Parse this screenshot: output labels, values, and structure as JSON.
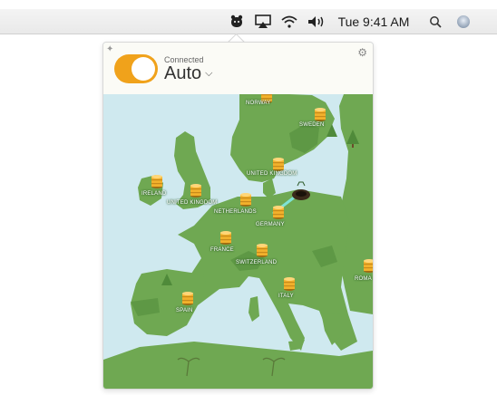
{
  "menubar": {
    "clock": "Tue 9:41 AM",
    "icons": [
      "tunnelbear-icon",
      "airplay-icon",
      "wifi-icon",
      "volume-icon",
      "search-icon",
      "siri-icon"
    ]
  },
  "popover": {
    "status": "Connected",
    "location": "Auto",
    "toggle_on": true,
    "accent": "#f0a21b"
  },
  "map": {
    "water_color": "#cfe9ef",
    "land_color": "#6fa852",
    "tunnels": [
      {
        "label": "NORWAY"
      },
      {
        "label": "SWEDEN"
      },
      {
        "label": "UNITED KINGDOM"
      },
      {
        "label": "IRELAND"
      },
      {
        "label": "UNITED KINGDOM"
      },
      {
        "label": "NETHERLANDS"
      },
      {
        "label": "GERMANY"
      },
      {
        "label": "FRANCE"
      },
      {
        "label": "SWITZERLAND"
      },
      {
        "label": "ITALY"
      },
      {
        "label": "SPAIN"
      },
      {
        "label": "ROMA"
      }
    ]
  }
}
